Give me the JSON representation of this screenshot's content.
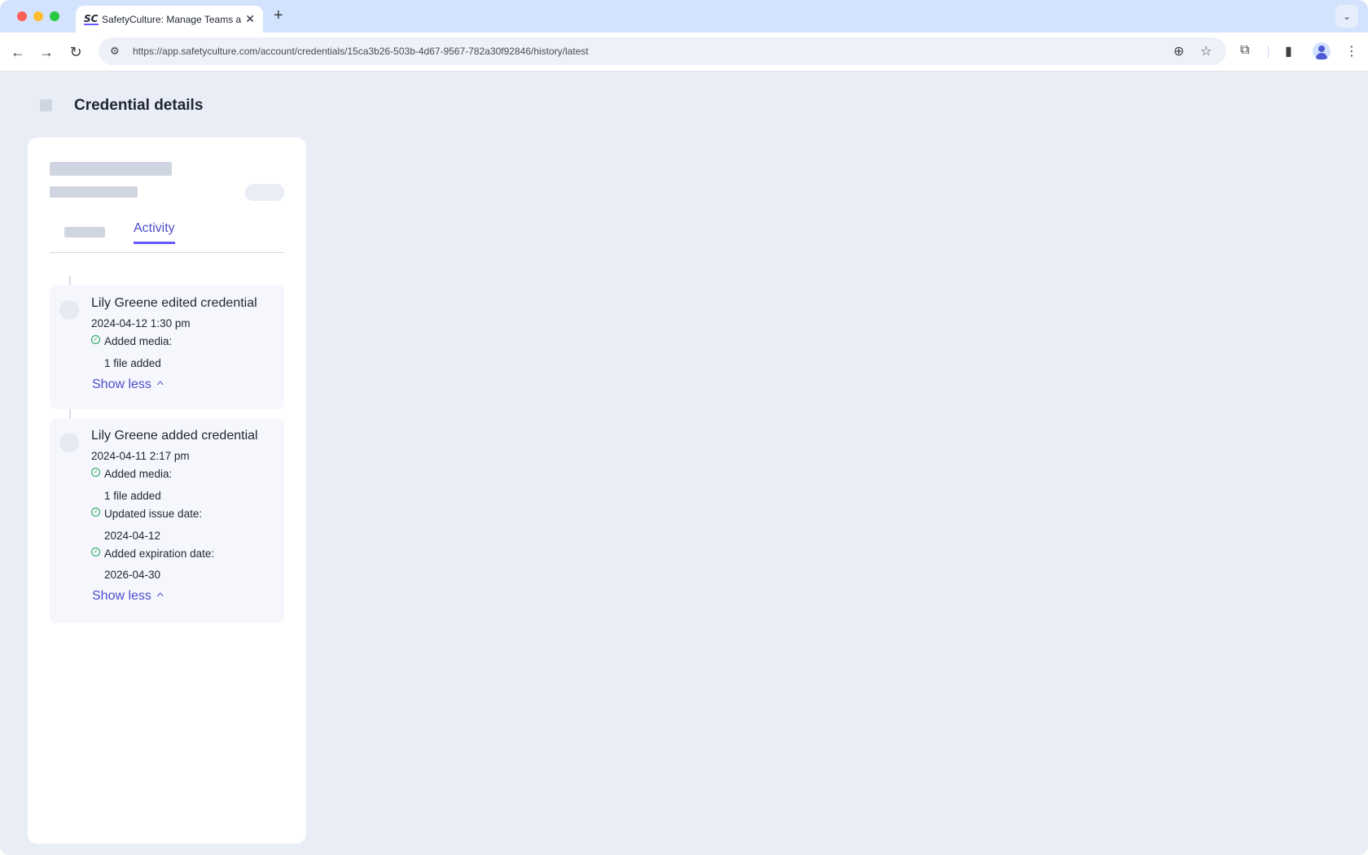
{
  "browser": {
    "tab": {
      "favicon": "SC",
      "title": "SafetyCulture: Manage Teams and...",
      "close": "✕"
    },
    "new_tab": "+",
    "tab_menu": "⌄",
    "nav": {
      "back": "←",
      "forward": "→",
      "reload": "↻"
    },
    "url": "https://app.safetyculture.com/account/credentials/15ca3b26-503b-4d67-9567-782a30f92846/history/latest",
    "icons": {
      "site_info": "⚙",
      "zoom": "⊕",
      "bookmark": "☆",
      "extensions": "⧉",
      "side_panel": "▮",
      "menu": "⋮"
    }
  },
  "page": {
    "title": "Credential details",
    "tabs": {
      "active": "Activity"
    },
    "activity": [
      {
        "title": "Lily Greene edited credential",
        "time": "2024-04-12 1:30 pm",
        "changes": [
          {
            "label": "Added media:",
            "value": "1 file added"
          }
        ],
        "toggle": "Show less"
      },
      {
        "title": "Lily Greene added credential",
        "time": "2024-04-11 2:17 pm",
        "changes": [
          {
            "label": "Added media:",
            "value": "1 file added"
          },
          {
            "label": "Updated issue date:",
            "value": "2024-04-12"
          },
          {
            "label": "Added expiration date:",
            "value": "2026-04-30"
          }
        ],
        "toggle": "Show less"
      }
    ],
    "toggle_chevron": "^"
  },
  "colors": {
    "accent": "#6559ff",
    "link": "#4d4ccc",
    "success": "#1fa35a",
    "background": "#e9edf6"
  }
}
